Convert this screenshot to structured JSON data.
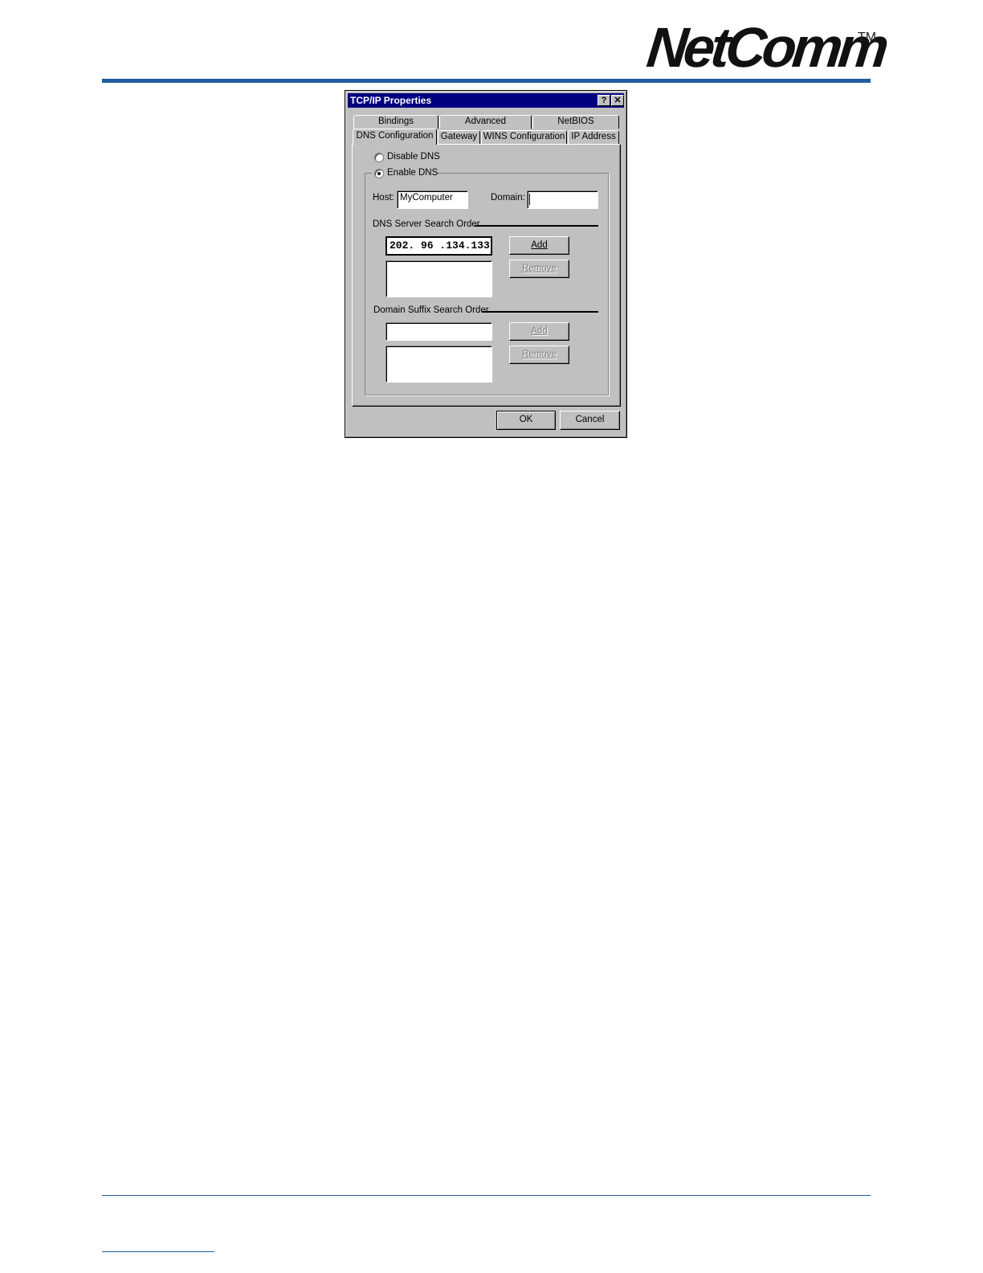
{
  "header": {
    "logo": "NetComm",
    "trademark": "TM"
  },
  "dialog": {
    "title": "TCP/IP Properties",
    "help_glyph": "?",
    "close_glyph": "✕",
    "tabs_back": [
      "Bindings",
      "Advanced",
      "NetBIOS"
    ],
    "tabs_front": [
      "DNS Configuration",
      "Gateway",
      "WINS Configuration",
      "IP Address"
    ],
    "active_tab": "DNS Configuration",
    "disable_dns_label": "Disable DNS",
    "enable_dns_label": "Enable DNS",
    "dns_enabled": true,
    "host_label": "Host:",
    "host_value": "MyComputer",
    "domain_label": "Domain:",
    "domain_value": "",
    "dns_server_group": "DNS Server Search Order",
    "dns_server_input": "202. 96 .134.133",
    "dns_server_list": [],
    "dns_add": "Add",
    "dns_remove": "Remove",
    "suffix_group": "Domain Suffix Search Order",
    "suffix_input": "",
    "suffix_list": [],
    "suffix_add": "Add",
    "suffix_remove": "Remove",
    "ok": "OK",
    "cancel": "Cancel"
  }
}
